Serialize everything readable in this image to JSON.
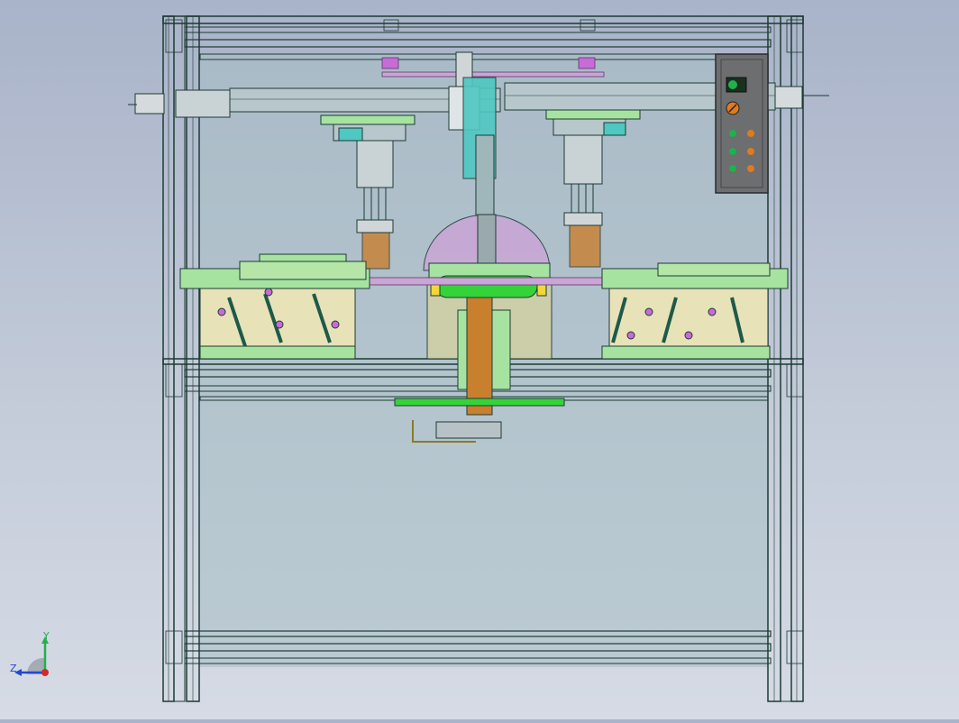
{
  "viewport": {
    "background_top": "#a9b3c9",
    "background_bottom": "#d6dbe5"
  },
  "model": {
    "frame_color": "#1d3b33",
    "panel_fill": "#a7bfc4",
    "fixture_green": "#a6e3a0",
    "accent_cyan": "#4fc7c2",
    "accent_magenta": "#c86ad8",
    "roller_green": "#35d33a",
    "shaft_orange": "#c8802f"
  },
  "control_panel": {
    "lamp_colors": [
      "#1fb14a",
      "#e07a20"
    ],
    "button_rows": 3
  },
  "triad": {
    "y_label": "Y",
    "z_label": "Z",
    "y_color": "#22b14c",
    "z_color": "#2447d4",
    "x_color": "#d62828"
  }
}
